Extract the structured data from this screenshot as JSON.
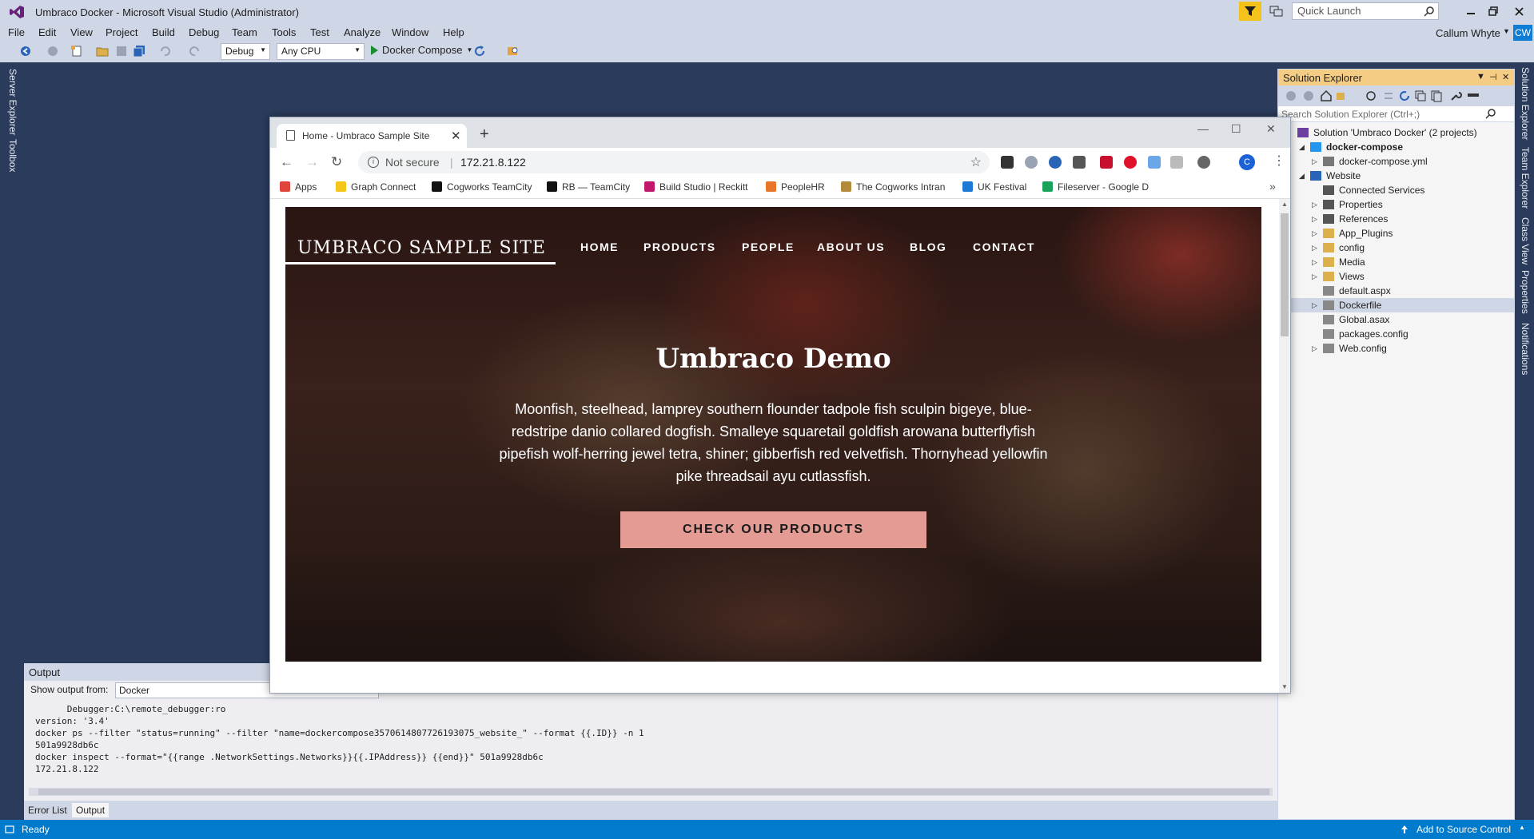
{
  "window": {
    "title": "Umbraco Docker - Microsoft Visual Studio  (Administrator)"
  },
  "quick_launch": {
    "placeholder": "Quick Launch"
  },
  "menu": [
    "File",
    "Edit",
    "View",
    "Project",
    "Build",
    "Debug",
    "Team",
    "Tools",
    "Test",
    "Analyze",
    "Window",
    "Help"
  ],
  "account": {
    "user": "Callum Whyte",
    "initials": "CW"
  },
  "toolbar": {
    "configuration": "Debug",
    "platform": "Any CPU",
    "run_target": "Docker Compose"
  },
  "left_tabs": [
    "Server Explorer",
    "Toolbox"
  ],
  "right_tabs": [
    "Solution Explorer",
    "Team Explorer",
    "Class View",
    "Properties",
    "Notifications"
  ],
  "solution_explorer": {
    "title": "Solution Explorer",
    "search_placeholder": "Search Solution Explorer (Ctrl+;)",
    "items": [
      {
        "label": "Solution 'Umbraco Docker' (2 projects)",
        "level": 0,
        "arrow": "",
        "icon": "solution-icon",
        "bold": false
      },
      {
        "label": "docker-compose",
        "level": 1,
        "arrow": "◢",
        "icon": "docker-project-icon",
        "bold": true
      },
      {
        "label": "docker-compose.yml",
        "level": 2,
        "arrow": "▷",
        "icon": "yaml-file-icon",
        "bold": false
      },
      {
        "label": "Website",
        "level": 1,
        "arrow": "◢",
        "icon": "web-project-icon",
        "bold": false
      },
      {
        "label": "Connected Services",
        "level": 2,
        "arrow": "",
        "icon": "connected-services-icon",
        "bold": false
      },
      {
        "label": "Properties",
        "level": 2,
        "arrow": "▷",
        "icon": "wrench-icon",
        "bold": false
      },
      {
        "label": "References",
        "level": 2,
        "arrow": "▷",
        "icon": "references-icon",
        "bold": false
      },
      {
        "label": "App_Plugins",
        "level": 2,
        "arrow": "▷",
        "icon": "folder-icon",
        "bold": false
      },
      {
        "label": "config",
        "level": 2,
        "arrow": "▷",
        "icon": "folder-icon",
        "bold": false
      },
      {
        "label": "Media",
        "level": 2,
        "arrow": "▷",
        "icon": "folder-icon",
        "bold": false
      },
      {
        "label": "Views",
        "level": 2,
        "arrow": "▷",
        "icon": "folder-icon",
        "bold": false
      },
      {
        "label": "default.aspx",
        "level": 2,
        "arrow": "",
        "icon": "aspx-file-icon",
        "bold": false
      },
      {
        "label": "Dockerfile",
        "level": 2,
        "arrow": "▷",
        "icon": "file-icon",
        "bold": false,
        "selected": true
      },
      {
        "label": "Global.asax",
        "level": 2,
        "arrow": "",
        "icon": "asax-file-icon",
        "bold": false
      },
      {
        "label": "packages.config",
        "level": 2,
        "arrow": "",
        "icon": "config-file-icon",
        "bold": false
      },
      {
        "label": "Web.config",
        "level": 2,
        "arrow": "▷",
        "icon": "config-file-icon",
        "bold": false
      }
    ]
  },
  "output": {
    "title": "Output",
    "show_from_label": "Show output from:",
    "source": "Docker",
    "lines": [
      "      Debugger:C:\\remote_debugger:ro",
      "version: '3.4'",
      "docker ps --filter \"status=running\" --filter \"name=dockercompose3570614807726193075_website_\" --format {{.ID}} -n 1",
      "501a9928db6c",
      "docker inspect --format=\"{{range .NetworkSettings.Networks}}{{.IPAddress}} {{end}}\" 501a9928db6c",
      "172.21.8.122"
    ],
    "tabs": [
      "Error List",
      "Output"
    ]
  },
  "status": {
    "left": "Ready",
    "right": "Add to Source Control"
  },
  "browser": {
    "tab_title": "Home - Umbraco Sample Site",
    "security": "Not secure",
    "url": "172.21.8.122",
    "profile_initial": "C",
    "bookmarks": [
      {
        "label": "Apps",
        "color": "#e0443a"
      },
      {
        "label": "Graph Connect",
        "color": "#f5c518"
      },
      {
        "label": "Cogworks TeamCity",
        "color": "#111111"
      },
      {
        "label": "RB — TeamCity",
        "color": "#111111"
      },
      {
        "label": "Build Studio | Reckitt",
        "color": "#c2186b"
      },
      {
        "label": "PeopleHR",
        "color": "#e8752a"
      },
      {
        "label": "The Cogworks Intran",
        "color": "#b28a3a"
      },
      {
        "label": "UK Festival",
        "color": "#1c7ad6"
      },
      {
        "label": "Fileserver - Google D",
        "color": "#1aa35b"
      }
    ]
  },
  "site": {
    "brand": "UMBRACO SAMPLE SITE",
    "nav": [
      "HOME",
      "PRODUCTS",
      "PEOPLE",
      "ABOUT US",
      "BLOG",
      "CONTACT"
    ],
    "hero_title": "Umbraco Demo",
    "hero_text": "Moonfish, steelhead, lamprey southern flounder tadpole fish sculpin bigeye, blue-redstripe danio collared dogfish. Smalleye squaretail goldfish arowana butterflyfish pipefish wolf-herring jewel tetra, shiner; gibberfish red velvetfish. Thornyhead yellowfin pike threadsail ayu cutlassfish.",
    "cta": "CHECK OUR PRODUCTS"
  },
  "colors": {
    "accent": "#007acc",
    "chrome": "#cfd6e5",
    "background": "#2b3b5c",
    "cta": "#e39b93",
    "panel_header": "#f5cc84"
  }
}
